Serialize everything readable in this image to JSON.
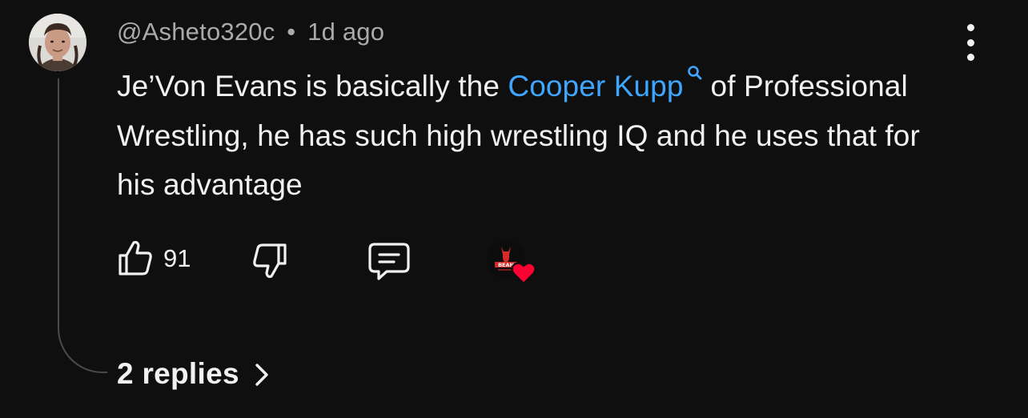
{
  "comment": {
    "author": "@Asheto320c",
    "separator": "•",
    "time": "1d ago",
    "text_before_link": "Je’Von Evans is basically the ",
    "link_text": "Cooper Kupp",
    "text_after_link": "of Professional Wrestling, he has such high wrestling IQ and he uses that for his advantage",
    "likes": "91",
    "replies_label": "2 replies",
    "creator_avatar_text": "BEAN",
    "colors": {
      "background": "#0f0f0f",
      "text": "#f1f1f1",
      "muted": "#aaaaaa",
      "link": "#3ea6ff",
      "heart": "#ff0033"
    },
    "icons": {
      "more": "more-vert-icon",
      "link": "search-icon",
      "like": "thumbs-up-icon",
      "dislike": "thumbs-down-icon",
      "reply": "comment-icon",
      "heart": "heart-icon",
      "chevron": "chevron-right-icon"
    }
  }
}
